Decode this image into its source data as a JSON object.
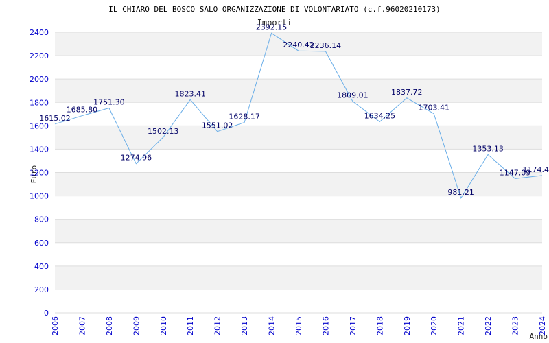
{
  "chart_data": {
    "type": "line",
    "title": "IL CHIARO DEL BOSCO SALO ORGANIZZAZIONE DI VOLONTARIATO (c.f.96020210173)",
    "subtitle": "Importi",
    "xlabel": "Anno",
    "ylabel": "Euro",
    "ylim": [
      0,
      2400
    ],
    "yticks": [
      0,
      200,
      400,
      600,
      800,
      1000,
      1200,
      1400,
      1600,
      1800,
      2000,
      2200,
      2400
    ],
    "grid": true,
    "categories": [
      "2006",
      "2007",
      "2008",
      "2009",
      "2010",
      "2011",
      "2012",
      "2013",
      "2014",
      "2015",
      "2016",
      "2017",
      "2018",
      "2019",
      "2020",
      "2021",
      "2022",
      "2023",
      "2024"
    ],
    "series": [
      {
        "values": [
          1615.02,
          1685.8,
          1751.3,
          1274.96,
          1502.13,
          1823.41,
          1551.02,
          1628.17,
          2392.15,
          2240.42,
          2236.14,
          1809.01,
          1634.25,
          1837.72,
          1703.41,
          981.21,
          1353.13,
          1147.09,
          1174.4
        ],
        "labels": [
          "1615.02",
          "1685.80",
          "1751.30",
          "1274.96",
          "1502.13",
          "1823.41",
          "1551.02",
          "1628.17",
          "2392.15",
          "2240.42",
          "2236.14",
          "1809.01",
          "1634.25",
          "1837.72",
          "1703.41",
          "981.21",
          "1353.13",
          "1147.09",
          "1174.4"
        ]
      }
    ],
    "colors": {
      "line": "#6aaee8",
      "tick_text": "#0000cc",
      "label_text": "#000066",
      "band": "#f2f2f2",
      "grid": "#dddddd"
    }
  }
}
